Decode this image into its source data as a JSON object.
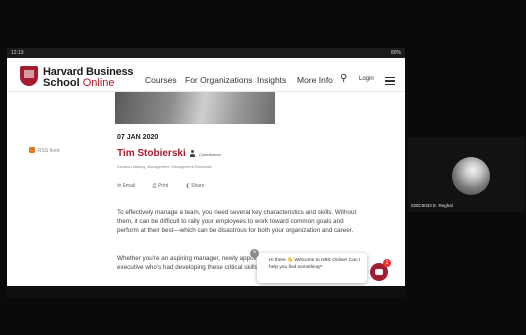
{
  "status_bar": {
    "time": "12:13",
    "battery": "80%"
  },
  "logo": {
    "line1": "Harvard Business",
    "school": "School",
    "online": "Online"
  },
  "nav": {
    "courses": "Courses",
    "for_organizations": "For Organizations",
    "insights": "Insights",
    "more_info": "More Info",
    "login": "Login"
  },
  "icons": {
    "search": "search-icon",
    "menu": "hamburger-menu-icon",
    "rss": "rss-icon",
    "person": "person-icon",
    "chat": "chat-icon"
  },
  "sidebar": {
    "rss_label": "RSS feed"
  },
  "article": {
    "date": "07 JAN 2020",
    "author": "Tim Stobierski",
    "author_role": "Contributors",
    "tags": "Decision-Making, Management, Management Essentials",
    "share": {
      "email": "Email",
      "print": "Print",
      "share": "Share"
    },
    "paragraph1": "To effectively manage a team, you need several key characteristics and skills. Without them, it can be difficult to rally your employees to work toward common goals and perform at their best—which can be disastrous for both your organization and career.",
    "paragraph2": "Whether you're an aspiring manager, newly appointed to a role, experience, or seasoned executive who's had developing these critical skills will prove crucial to your success."
  },
  "chat": {
    "greeting": "Hi there 👋 Welcome to HBS Online! Can I help you find something?",
    "close": "×",
    "badge": "1"
  },
  "participant": {
    "name": "020C5033 E. Reghal"
  },
  "colors": {
    "brand": "#a51c30",
    "background": "#0b0b0b"
  }
}
